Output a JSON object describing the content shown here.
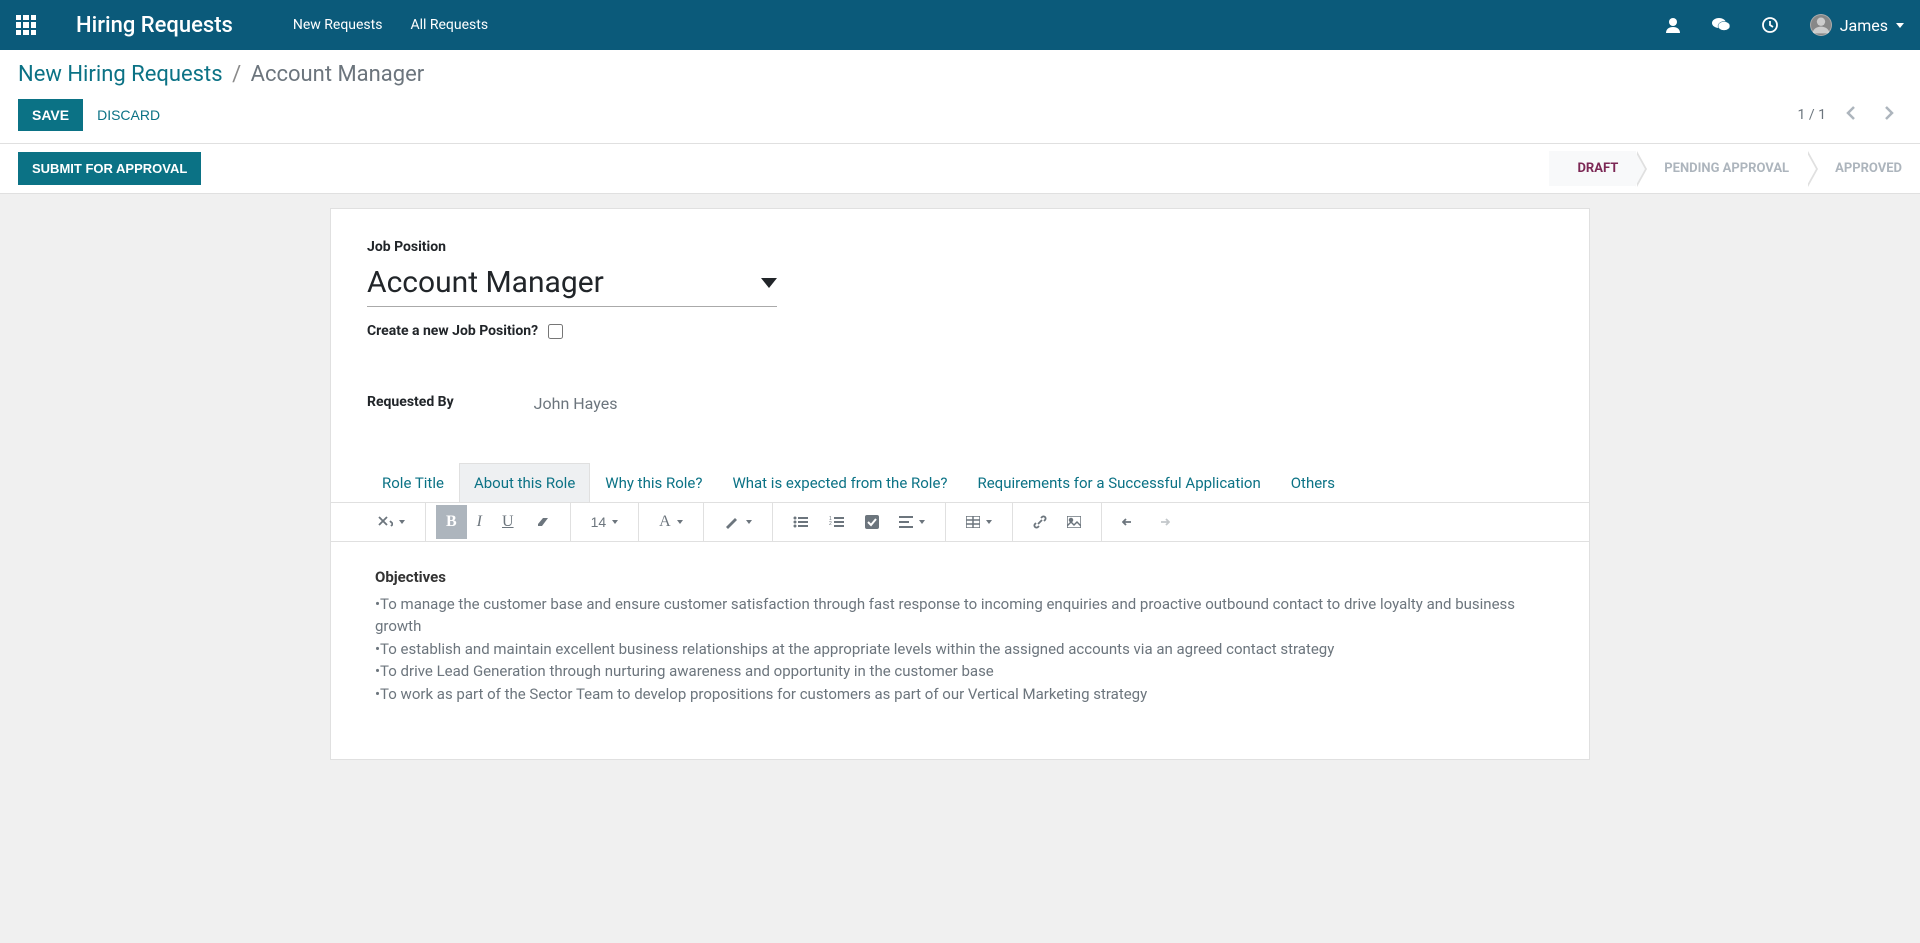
{
  "navbar": {
    "brand": "Hiring Requests",
    "links": [
      "New Requests",
      "All Requests"
    ],
    "user": "James"
  },
  "breadcrumb": {
    "parent": "New Hiring Requests",
    "current": "Account Manager"
  },
  "actions": {
    "save": "SAVE",
    "discard": "DISCARD",
    "pager": "1 / 1"
  },
  "status": {
    "submit": "SUBMIT FOR APPROVAL",
    "steps": [
      "DRAFT",
      "PENDING APPROVAL",
      "APPROVED"
    ]
  },
  "form": {
    "job_position_label": "Job Position",
    "job_position_value": "Account Manager",
    "create_new_label": "Create a new Job Position?",
    "requested_by_label": "Requested By",
    "requested_by_value": "John Hayes"
  },
  "tabs": [
    "Role Title",
    "About this Role",
    "Why this Role?",
    "What is expected from the Role?",
    "Requirements for a Successful Application",
    "Others"
  ],
  "toolbar": {
    "font_size": "14",
    "font_btn": "A"
  },
  "editor": {
    "heading": "Objectives",
    "lines": [
      "•To manage the customer base  and ensure customer satisfaction through fast response to incoming enquiries and proactive outbound contact to drive loyalty and business growth",
      "•To establish and maintain excellent business relationships at the appropriate levels within the assigned accounts via an agreed contact strategy",
      "•To drive Lead Generation through nurturing awareness and opportunity in the customer base",
      "•To work as part of the Sector Team to develop propositions for customers as part of our Vertical Marketing strategy"
    ]
  }
}
